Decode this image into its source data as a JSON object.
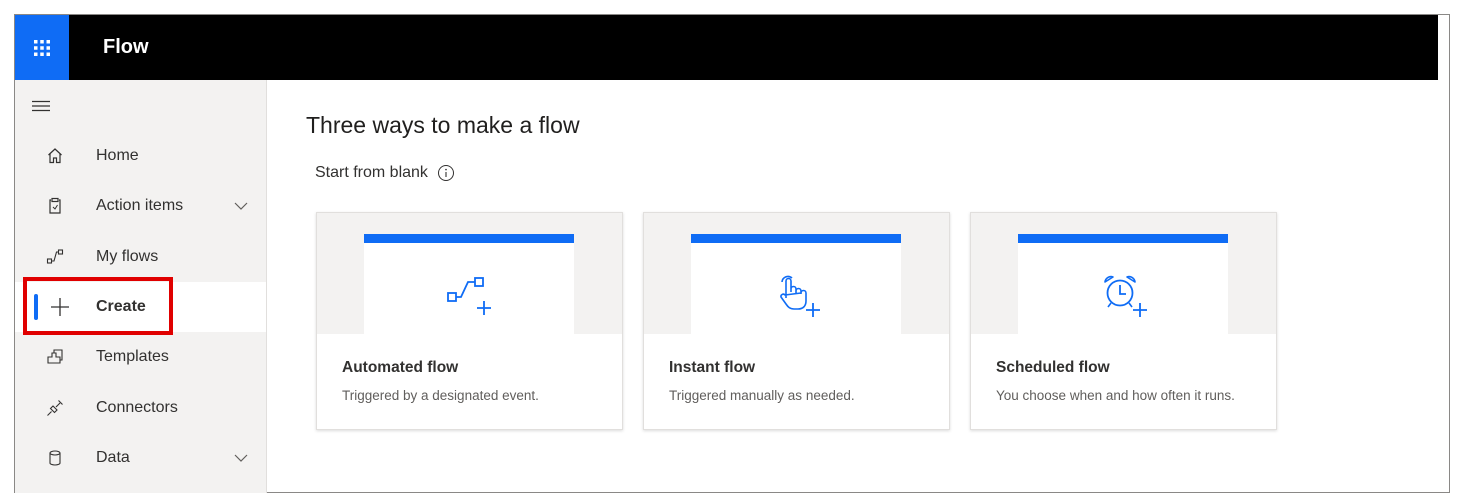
{
  "app": {
    "title": "Flow"
  },
  "sidebar": {
    "items": [
      {
        "label": "Home",
        "icon": "home-icon"
      },
      {
        "label": "Action items",
        "icon": "clipboard-icon",
        "expandable": true
      },
      {
        "label": "My flows",
        "icon": "flows-icon"
      },
      {
        "label": "Create",
        "icon": "plus-icon",
        "active": true
      },
      {
        "label": "Templates",
        "icon": "templates-icon"
      },
      {
        "label": "Connectors",
        "icon": "connectors-icon"
      },
      {
        "label": "Data",
        "icon": "database-icon",
        "expandable": true
      }
    ]
  },
  "main": {
    "title": "Three ways to make a flow",
    "subtitle": "Start from blank",
    "cards": [
      {
        "title": "Automated flow",
        "description": "Triggered by a designated event.",
        "icon": "automated-flow-icon"
      },
      {
        "title": "Instant flow",
        "description": "Triggered manually as needed.",
        "icon": "touch-icon"
      },
      {
        "title": "Scheduled flow",
        "description": "You choose when and how often it runs.",
        "icon": "alarm-clock-icon"
      }
    ]
  },
  "colors": {
    "accent": "#0f6cf5",
    "topbar": "#000000",
    "sidebar": "#f3f2f1",
    "highlight": "#e00000"
  }
}
